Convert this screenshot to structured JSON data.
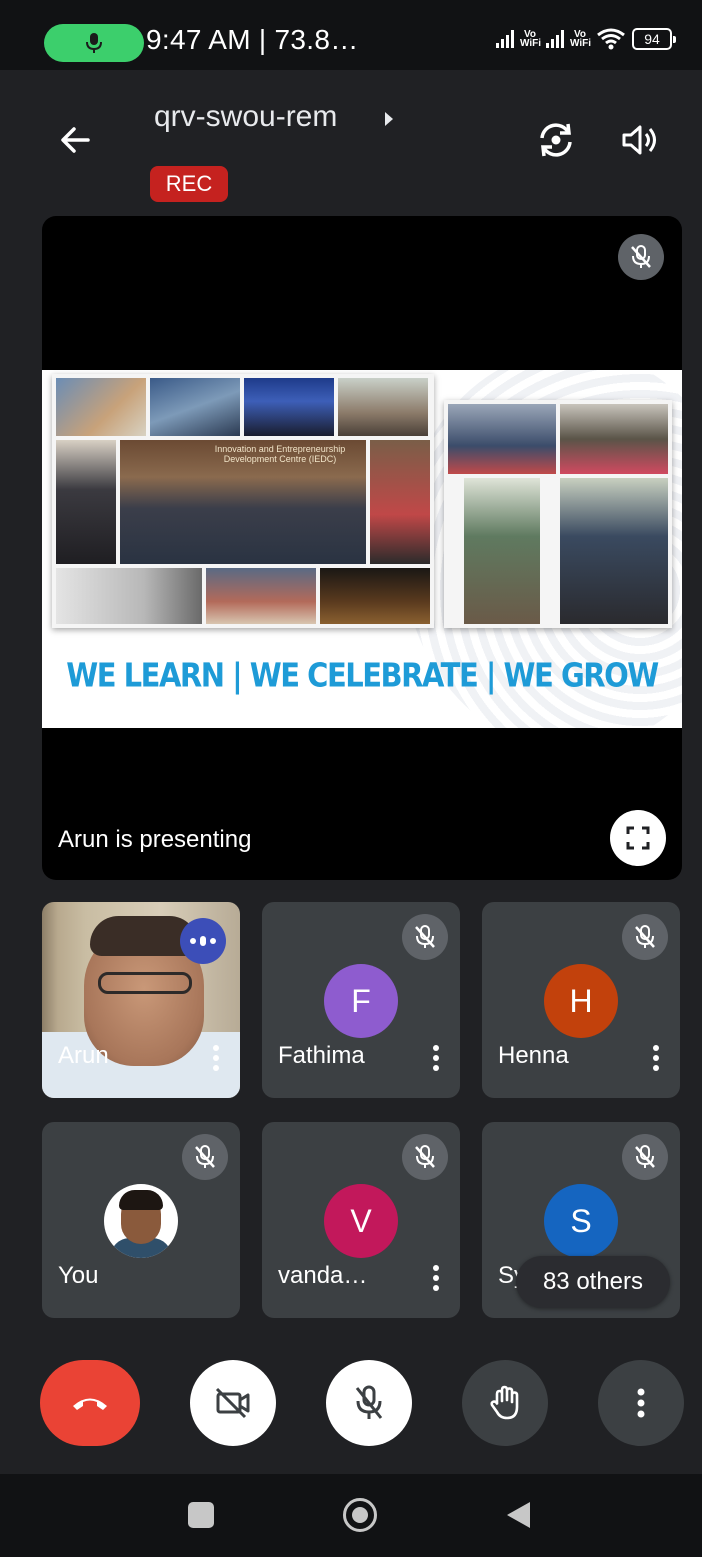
{
  "status_bar": {
    "time": "9:47 AM | 73.8…",
    "battery": "94",
    "network_labels": [
      "Vo WiFi",
      "Vo WiFi"
    ],
    "active_call_color": "#3ccf6c"
  },
  "header": {
    "meeting_code": "qrv-swou-rem",
    "recording_badge": "REC",
    "icons": [
      "back-arrow-icon",
      "caret-right-icon",
      "switch-camera-icon",
      "speaker-icon"
    ]
  },
  "presentation": {
    "presenting_label": "Arun is presenting",
    "slide_tagline": "WE LEARN | WE CELEBRATE | WE GROW",
    "slide_sign_text": "Innovation and Entrepreneurship Development Centre (IEDC)",
    "tagline_color": "#1e9bd7"
  },
  "participants": [
    {
      "name": "Arun",
      "state": "speaking",
      "video": true
    },
    {
      "name": "Fathima",
      "initial": "F",
      "muted": true,
      "color": "#8e5ccf"
    },
    {
      "name": "Henna",
      "initial": "H",
      "muted": true,
      "color": "#c2410c"
    },
    {
      "name": "You",
      "muted": true,
      "photo": true
    },
    {
      "name": "vanda…",
      "initial": "V",
      "muted": true,
      "color": "#c2185b"
    },
    {
      "name": "Sy",
      "initial": "S",
      "muted": true,
      "color": "#1565c0"
    }
  ],
  "others_label": "83 others",
  "controls": {
    "end_call_color": "#ea4335",
    "buttons": [
      "end-call",
      "camera-off",
      "mic-off",
      "raise-hand",
      "more-options"
    ]
  }
}
